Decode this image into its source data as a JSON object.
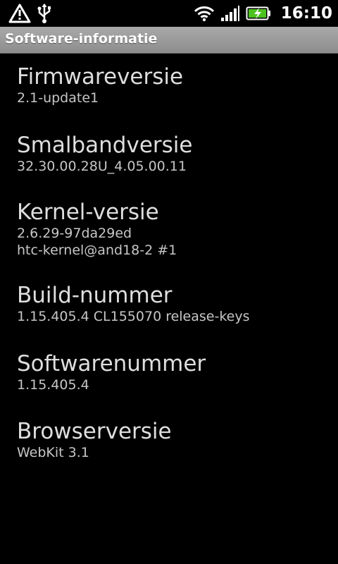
{
  "status_bar": {
    "time": "16:10",
    "icons": [
      "warning-icon",
      "usb-icon",
      "wifi-icon",
      "signal-icon",
      "battery-charging-icon"
    ],
    "colors": {
      "battery_fill": "#4cc21f",
      "background": "#000000"
    }
  },
  "title_bar": {
    "title": "Software-informatie"
  },
  "items": [
    {
      "title": "Firmwareversie",
      "lines": [
        "2.1-update1"
      ]
    },
    {
      "title": "Smalbandversie",
      "lines": [
        "32.30.00.28U_4.05.00.11"
      ]
    },
    {
      "title": "Kernel-versie",
      "lines": [
        "2.6.29-97da29ed",
        "htc-kernel@and18-2 #1"
      ]
    },
    {
      "title": "Build-nummer",
      "lines": [
        "1.15.405.4 CL155070 release-keys"
      ]
    },
    {
      "title": "Softwarenummer",
      "lines": [
        "1.15.405.4"
      ]
    },
    {
      "title": "Browserversie",
      "lines": [
        "WebKit 3.1"
      ]
    }
  ]
}
